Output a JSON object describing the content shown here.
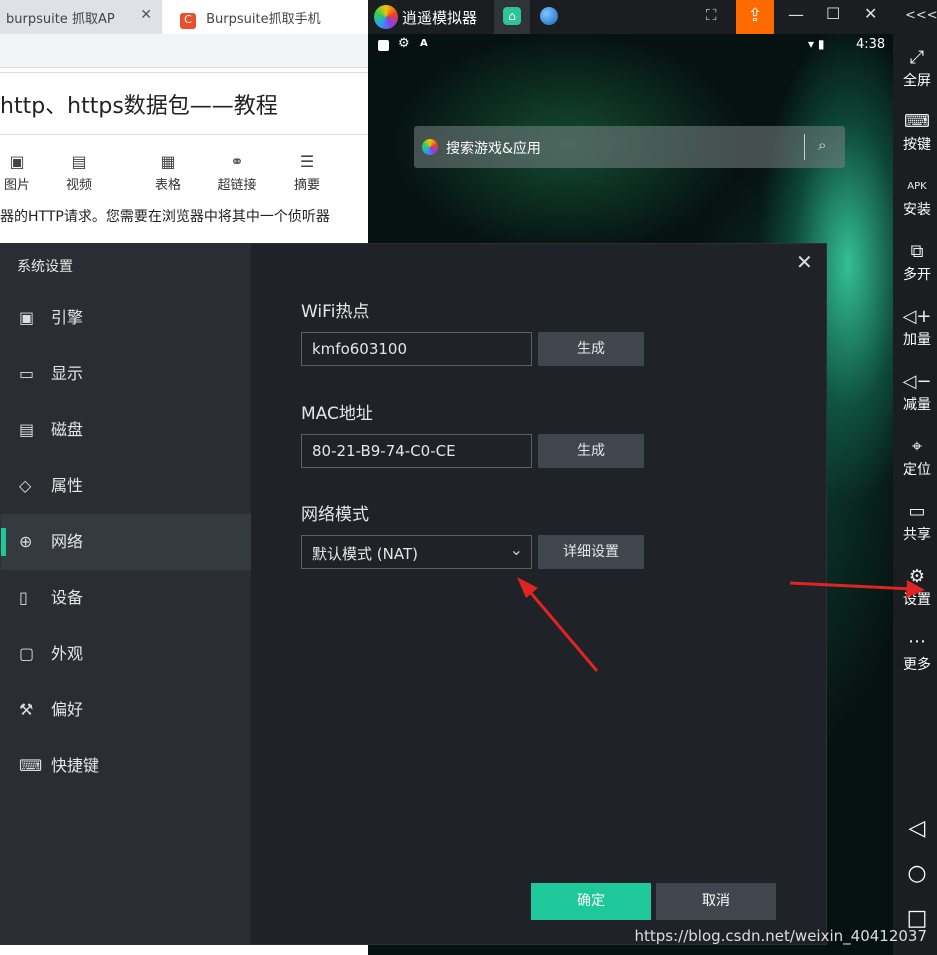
{
  "browser": {
    "tabs": [
      {
        "label": "burpsuite 抓取AP"
      },
      {
        "label": "Burpsuite抓取手机"
      }
    ],
    "article_title": "http、https数据包——教程",
    "toolbar": [
      {
        "label": "图片",
        "icon": "image-icon"
      },
      {
        "label": "视频",
        "icon": "video-icon"
      },
      {
        "label": "表格",
        "icon": "table-icon"
      },
      {
        "label": "超链接",
        "icon": "link-icon"
      },
      {
        "label": "摘要",
        "icon": "summary-icon"
      }
    ],
    "body_text": "器的HTTP请求。您需要在浏览器中将其中一个侦听器"
  },
  "emulator": {
    "title": "逍遥模拟器",
    "status_time": "4:38",
    "search_placeholder": "搜索游戏&应用",
    "sidebar": [
      {
        "label": "全屏",
        "icon": "fullscreen-icon"
      },
      {
        "label": "按键",
        "icon": "keyboard-icon"
      },
      {
        "label": "安装",
        "icon": "apk-icon"
      },
      {
        "label": "多开",
        "icon": "multi-instance-icon"
      },
      {
        "label": "加量",
        "icon": "volume-up-icon"
      },
      {
        "label": "减量",
        "icon": "volume-down-icon"
      },
      {
        "label": "定位",
        "icon": "location-icon"
      },
      {
        "label": "共享",
        "icon": "folder-icon"
      },
      {
        "label": "设置",
        "icon": "gear-icon"
      },
      {
        "label": "更多",
        "icon": "more-icon"
      }
    ],
    "collapse_label": "<<<"
  },
  "dialog": {
    "title": "系统设置",
    "nav": [
      {
        "label": "引擎",
        "icon": "chip-icon"
      },
      {
        "label": "显示",
        "icon": "monitor-icon"
      },
      {
        "label": "磁盘",
        "icon": "disk-icon"
      },
      {
        "label": "属性",
        "icon": "tag-icon"
      },
      {
        "label": "网络",
        "icon": "globe-icon",
        "active": true
      },
      {
        "label": "设备",
        "icon": "phone-icon"
      },
      {
        "label": "外观",
        "icon": "window-icon"
      },
      {
        "label": "偏好",
        "icon": "wrench-icon"
      },
      {
        "label": "快捷键",
        "icon": "keyboard-icon"
      }
    ],
    "wifi_label": "WiFi热点",
    "wifi_value": "kmfo603100",
    "generate_label": "生成",
    "mac_label": "MAC地址",
    "mac_value": "80-21-B9-74-C0-CE",
    "network_label": "网络模式",
    "network_value": "默认模式 (NAT)",
    "detail_label": "详细设置",
    "ok_label": "确定",
    "cancel_label": "取消"
  },
  "watermark": "https://blog.csdn.net/weixin_40412037",
  "colors": {
    "accent": "#1fc89a",
    "arrow": "#e02424",
    "upload": "#ff6a00"
  }
}
